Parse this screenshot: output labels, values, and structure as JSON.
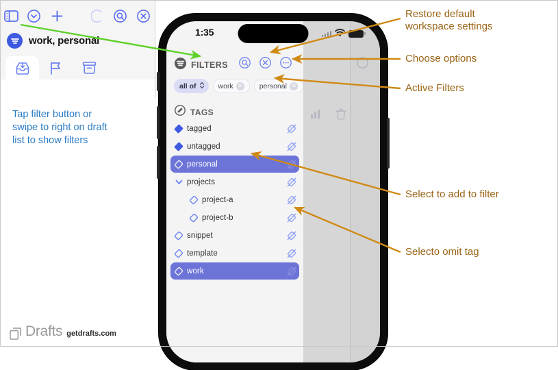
{
  "left_panel": {
    "toolbar_icons": [
      "sidebar-toggle-icon",
      "chevron-down-circle-icon",
      "plus-icon",
      "loading-spinner-icon",
      "search-circle-icon",
      "close-circle-icon"
    ],
    "workspace_title": "work, personal",
    "workspace_badge": "filter-lines-icon",
    "tabs": [
      {
        "name": "inbox",
        "icon": "inbox-tray-icon",
        "active": true
      },
      {
        "name": "flagged",
        "icon": "flag-icon",
        "active": false
      },
      {
        "name": "archive",
        "icon": "archive-box-icon",
        "active": false
      }
    ]
  },
  "phone": {
    "status_bar": {
      "time": "1:35",
      "wifi": "wifi-icon",
      "battery": "battery-icon"
    },
    "filters": {
      "header_label": "FILTERS",
      "header_icon": "filter-lines-icon",
      "actions": [
        {
          "name": "search-filters",
          "icon": "search-circle-icon"
        },
        {
          "name": "clear-filters",
          "icon": "close-circle-icon"
        },
        {
          "name": "more-options",
          "icon": "ellipsis-circle-icon"
        }
      ],
      "chips": [
        {
          "label": "all of",
          "type": "selector",
          "has_stepper": true
        },
        {
          "label": "work",
          "type": "tag",
          "removable": true
        },
        {
          "label": "personal",
          "type": "tag",
          "removable": true
        }
      ]
    },
    "tags_section": {
      "header_label": "TAGS",
      "header_icon": "tag-circle-icon",
      "rows": [
        {
          "label": "tagged",
          "icon": "tag-solid-icon",
          "selected": false,
          "indent": false,
          "disclosure": null,
          "omit_icon": "tag-slash-icon"
        },
        {
          "label": "untagged",
          "icon": "tag-solid-icon",
          "selected": false,
          "indent": false,
          "disclosure": null,
          "omit_icon": "tag-slash-icon"
        },
        {
          "label": "personal",
          "icon": "tag-outline-icon",
          "selected": true,
          "indent": false,
          "disclosure": null,
          "omit_icon": "tag-slash-icon"
        },
        {
          "label": "projects",
          "icon": null,
          "selected": false,
          "indent": false,
          "disclosure": "chevron-down-icon",
          "omit_icon": "tag-slash-icon"
        },
        {
          "label": "project-a",
          "icon": "tag-outline-icon",
          "selected": false,
          "indent": true,
          "disclosure": null,
          "omit_icon": "tag-slash-icon"
        },
        {
          "label": "project-b",
          "icon": "tag-outline-icon",
          "selected": false,
          "indent": true,
          "disclosure": null,
          "omit_icon": "tag-slash-icon"
        },
        {
          "label": "snippet",
          "icon": "tag-outline-icon",
          "selected": false,
          "indent": false,
          "disclosure": null,
          "omit_icon": "tag-slash-icon"
        },
        {
          "label": "template",
          "icon": "tag-outline-icon",
          "selected": false,
          "indent": false,
          "disclosure": null,
          "omit_icon": "tag-slash-icon"
        },
        {
          "label": "work",
          "icon": "tag-outline-icon",
          "selected": true,
          "indent": false,
          "disclosure": null,
          "omit_icon": "tag-slash-icon"
        }
      ]
    },
    "background_pane_icons": [
      "circle-icon",
      "search-icon",
      "split-view-icon",
      "chart-bars-icon",
      "trash-icon"
    ]
  },
  "annotations": {
    "blue_note": "Tap filter button or\nswipe to right on draft\nlist to show filters",
    "callouts": [
      {
        "id": "restore-default",
        "text": "Restore default\nworkspace settings"
      },
      {
        "id": "choose-options",
        "text": "Choose options"
      },
      {
        "id": "active-filters",
        "text": "Active Filters"
      },
      {
        "id": "select-add",
        "text": "Select to add to filter"
      },
      {
        "id": "select-omit",
        "text": "Selecto omit tag"
      }
    ]
  },
  "footer": {
    "brand": "Drafts",
    "url": "getdrafts.com",
    "mark": "drafts-logo-icon"
  },
  "colors": {
    "accent_blue": "#6c83f2",
    "selected_row": "#6d74d8",
    "callout_orange": "#d08a16",
    "callout_text": "#9a6314",
    "note_blue": "#2b7cc4",
    "green_arrow": "#5fd12a"
  }
}
